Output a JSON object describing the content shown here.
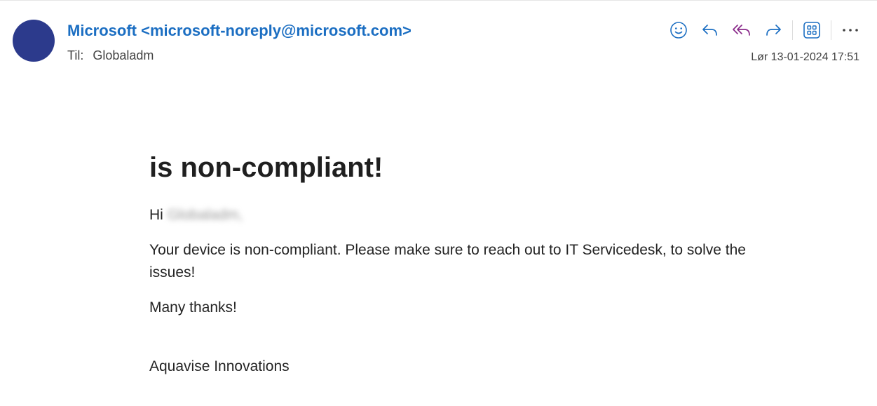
{
  "header": {
    "sender_display": "Microsoft <microsoft-noreply@microsoft.com>",
    "to_label": "Til:",
    "to_value": "Globaladm",
    "timestamp": "Lør 13-01-2024 17:51"
  },
  "toolbar": {
    "icons": [
      "emoji-icon",
      "reply-icon",
      "reply-all-icon",
      "forward-icon",
      "apps-icon",
      "more-icon"
    ],
    "accent_color": "#1b6ec2",
    "reply_all_color": "#8a2a8a"
  },
  "message": {
    "title": "is non-compliant!",
    "greeting": "Hi",
    "greeting_name": "Globaladm,",
    "paragraph": "Your device is non-compliant. Please make sure to reach out to IT Servicedesk, to solve the issues!",
    "thanks": "Many thanks!",
    "signature": "Aquavise Innovations"
  },
  "avatar_color": "#2c3a8c"
}
